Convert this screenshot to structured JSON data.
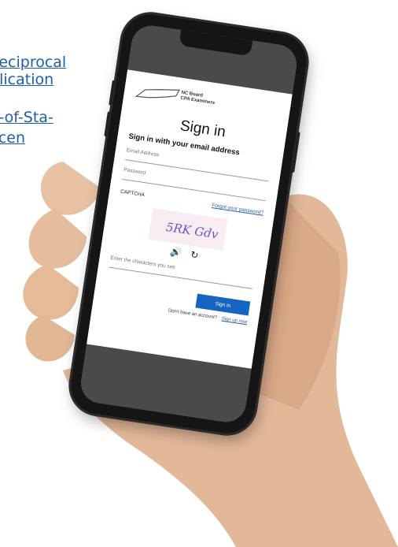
{
  "background_links": [
    "Reciprocal",
    "Application",
    "Out-of-Sta-",
    "Licen"
  ],
  "logo": {
    "line1": "NC Board",
    "line2": "CPA Examiners"
  },
  "signin": {
    "title": "Sign in",
    "subtitle": "Sign in with your email address",
    "email_placeholder": "Email Address",
    "password_placeholder": "Password",
    "captcha_label": "CAPTCHA",
    "forgot_link": "Forgot your password?",
    "captcha_text": "5RK Gdv",
    "captcha_input_placeholder": "Enter the characters you see",
    "signin_button": "Sign in",
    "no_account_text": "Don't have an account?",
    "signup_link": "Sign up now"
  },
  "colors": {
    "link": "#1d5fa8",
    "button": "#1565c0",
    "skin": "#e2b898"
  },
  "icons": {
    "audio": "speaker-icon",
    "refresh": "refresh-icon"
  }
}
